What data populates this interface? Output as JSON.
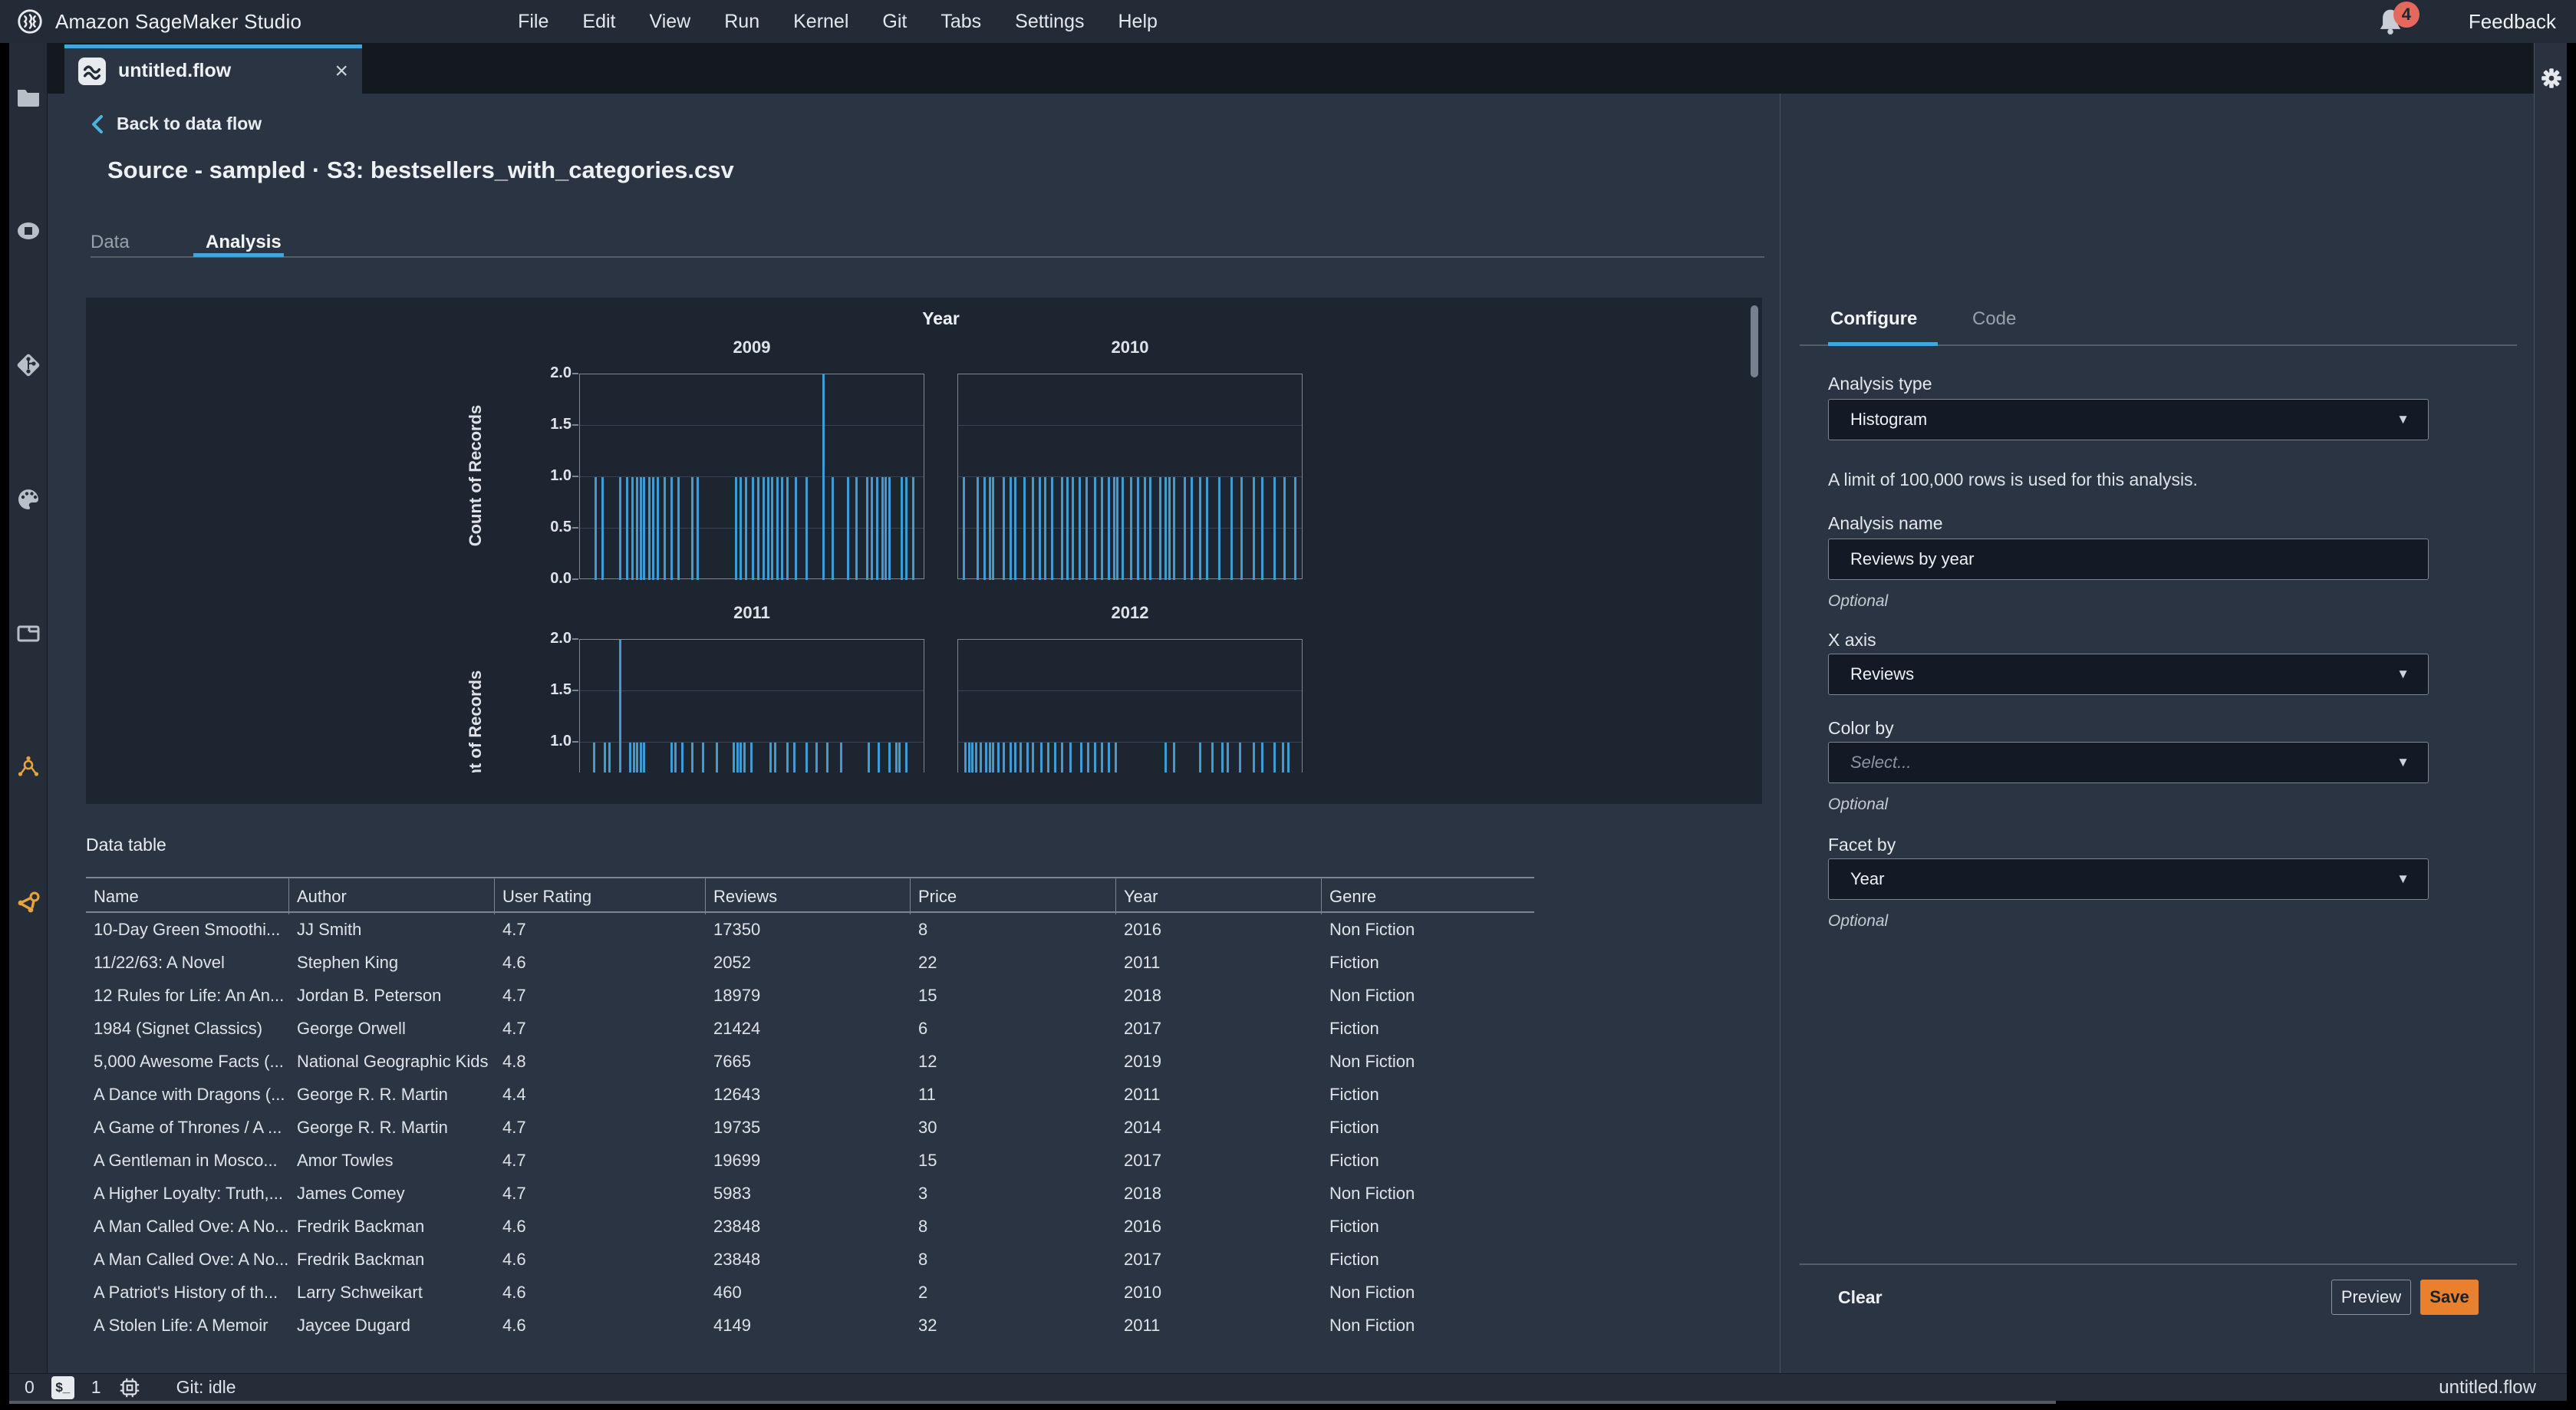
{
  "menu_bar": {
    "brand": "Amazon SageMaker Studio",
    "items": [
      "File",
      "Edit",
      "View",
      "Run",
      "Kernel",
      "Git",
      "Tabs",
      "Settings",
      "Help"
    ],
    "notification_count": "4",
    "feedback_label": "Feedback"
  },
  "sidebar": {
    "items": [
      {
        "name": "file-browser"
      },
      {
        "name": "running-sessions"
      },
      {
        "name": "git"
      },
      {
        "name": "commands-palette"
      },
      {
        "name": "open-tabs"
      },
      {
        "name": "experiments"
      },
      {
        "name": "data-flow"
      }
    ]
  },
  "tab_bar": {
    "active_tab": "untitled.flow",
    "close_glyph": "×"
  },
  "page": {
    "back_link": "Back to data flow",
    "title": "Source - sampled · S3: bestsellers_with_categories.csv",
    "tabs": [
      {
        "label": "Data",
        "active": false
      },
      {
        "label": "Analysis",
        "active": true
      }
    ]
  },
  "chart_data": {
    "type": "bar",
    "subtype": "histogram",
    "title": "Year",
    "ylabel": "Count of Records",
    "x_field": "Reviews",
    "facet_field": "Year",
    "ylim": [
      0,
      2
    ],
    "y_ticks_row1": [
      "2.0",
      "1.5",
      "1.0",
      "0.5",
      "0.0"
    ],
    "y_ticks_row2": [
      "2.0",
      "1.5",
      "1.0"
    ],
    "grid": true,
    "bar_color": "#3f9bd1",
    "facets": [
      {
        "year": "2009",
        "bars": [
          [
            0.045,
            1
          ],
          [
            0.065,
            1
          ],
          [
            0.115,
            1
          ],
          [
            0.135,
            1
          ],
          [
            0.15,
            1
          ],
          [
            0.165,
            1
          ],
          [
            0.175,
            1
          ],
          [
            0.185,
            1
          ],
          [
            0.2,
            1
          ],
          [
            0.21,
            1
          ],
          [
            0.225,
            1
          ],
          [
            0.245,
            1
          ],
          [
            0.265,
            1
          ],
          [
            0.285,
            1
          ],
          [
            0.325,
            1
          ],
          [
            0.34,
            1
          ],
          [
            0.45,
            1
          ],
          [
            0.465,
            1
          ],
          [
            0.48,
            1
          ],
          [
            0.5,
            1
          ],
          [
            0.515,
            1
          ],
          [
            0.53,
            1
          ],
          [
            0.545,
            1
          ],
          [
            0.555,
            1
          ],
          [
            0.57,
            1
          ],
          [
            0.585,
            1
          ],
          [
            0.6,
            1
          ],
          [
            0.625,
            1
          ],
          [
            0.655,
            1
          ],
          [
            0.705,
            2
          ],
          [
            0.73,
            1
          ],
          [
            0.775,
            1
          ],
          [
            0.8,
            1
          ],
          [
            0.83,
            1
          ],
          [
            0.845,
            1
          ],
          [
            0.86,
            1
          ],
          [
            0.875,
            1
          ],
          [
            0.885,
            1
          ],
          [
            0.895,
            1
          ],
          [
            0.93,
            1
          ],
          [
            0.945,
            1
          ],
          [
            0.965,
            1
          ]
        ]
      },
      {
        "year": "2010",
        "bars": [
          [
            0.015,
            1
          ],
          [
            0.055,
            1
          ],
          [
            0.075,
            1
          ],
          [
            0.09,
            1
          ],
          [
            0.1,
            1
          ],
          [
            0.13,
            1
          ],
          [
            0.15,
            1
          ],
          [
            0.165,
            1
          ],
          [
            0.19,
            1
          ],
          [
            0.215,
            1
          ],
          [
            0.235,
            1
          ],
          [
            0.25,
            1
          ],
          [
            0.27,
            1
          ],
          [
            0.3,
            1
          ],
          [
            0.315,
            1
          ],
          [
            0.33,
            1
          ],
          [
            0.35,
            1
          ],
          [
            0.37,
            1
          ],
          [
            0.395,
            1
          ],
          [
            0.415,
            1
          ],
          [
            0.435,
            1
          ],
          [
            0.45,
            1
          ],
          [
            0.46,
            1
          ],
          [
            0.475,
            1
          ],
          [
            0.5,
            1
          ],
          [
            0.52,
            1
          ],
          [
            0.54,
            1
          ],
          [
            0.555,
            1
          ],
          [
            0.585,
            1
          ],
          [
            0.6,
            1
          ],
          [
            0.61,
            1
          ],
          [
            0.625,
            1
          ],
          [
            0.655,
            1
          ],
          [
            0.675,
            1
          ],
          [
            0.7,
            1
          ],
          [
            0.72,
            1
          ],
          [
            0.755,
            1
          ],
          [
            0.79,
            1
          ],
          [
            0.82,
            1
          ],
          [
            0.855,
            1
          ],
          [
            0.88,
            1
          ],
          [
            0.915,
            1
          ],
          [
            0.945,
            1
          ],
          [
            0.975,
            1
          ]
        ]
      },
      {
        "year": "2011",
        "bars": [
          [
            0.04,
            1
          ],
          [
            0.07,
            1
          ],
          [
            0.085,
            1
          ],
          [
            0.115,
            2
          ],
          [
            0.145,
            1
          ],
          [
            0.155,
            1
          ],
          [
            0.165,
            1
          ],
          [
            0.175,
            1
          ],
          [
            0.185,
            1
          ],
          [
            0.265,
            1
          ],
          [
            0.275,
            1
          ],
          [
            0.295,
            1
          ],
          [
            0.325,
            1
          ],
          [
            0.355,
            1
          ],
          [
            0.395,
            1
          ],
          [
            0.445,
            1
          ],
          [
            0.455,
            1
          ],
          [
            0.465,
            1
          ],
          [
            0.475,
            1
          ],
          [
            0.495,
            1
          ],
          [
            0.55,
            1
          ],
          [
            0.565,
            1
          ],
          [
            0.6,
            1
          ],
          [
            0.62,
            1
          ],
          [
            0.655,
            1
          ],
          [
            0.685,
            1
          ],
          [
            0.715,
            1
          ],
          [
            0.755,
            1
          ],
          [
            0.835,
            1
          ],
          [
            0.865,
            1
          ],
          [
            0.895,
            1
          ],
          [
            0.915,
            1
          ],
          [
            0.925,
            1
          ],
          [
            0.945,
            1
          ]
        ]
      },
      {
        "year": "2012",
        "bars": [
          [
            0.02,
            1
          ],
          [
            0.03,
            1
          ],
          [
            0.04,
            1
          ],
          [
            0.05,
            1
          ],
          [
            0.065,
            1
          ],
          [
            0.08,
            1
          ],
          [
            0.09,
            1
          ],
          [
            0.1,
            1
          ],
          [
            0.115,
            1
          ],
          [
            0.13,
            1
          ],
          [
            0.15,
            1
          ],
          [
            0.165,
            1
          ],
          [
            0.18,
            1
          ],
          [
            0.2,
            1
          ],
          [
            0.215,
            1
          ],
          [
            0.24,
            1
          ],
          [
            0.26,
            1
          ],
          [
            0.28,
            1
          ],
          [
            0.3,
            1
          ],
          [
            0.325,
            1
          ],
          [
            0.355,
            1
          ],
          [
            0.375,
            1
          ],
          [
            0.395,
            1
          ],
          [
            0.415,
            1
          ],
          [
            0.435,
            1
          ],
          [
            0.455,
            1
          ],
          [
            0.6,
            1
          ],
          [
            0.625,
            1
          ],
          [
            0.7,
            1
          ],
          [
            0.735,
            1
          ],
          [
            0.765,
            1
          ],
          [
            0.78,
            1
          ],
          [
            0.815,
            1
          ],
          [
            0.855,
            1
          ],
          [
            0.88,
            1
          ],
          [
            0.915,
            1
          ],
          [
            0.94,
            1
          ],
          [
            0.955,
            1
          ]
        ]
      }
    ]
  },
  "data_table": {
    "label": "Data table",
    "columns": [
      "Name",
      "Author",
      "User Rating",
      "Reviews",
      "Price",
      "Year",
      "Genre"
    ],
    "rows": [
      [
        "10-Day Green Smoothi...",
        "JJ Smith",
        "4.7",
        "17350",
        "8",
        "2016",
        "Non Fiction"
      ],
      [
        "11/22/63: A Novel",
        "Stephen King",
        "4.6",
        "2052",
        "22",
        "2011",
        "Fiction"
      ],
      [
        "12 Rules for Life: An An...",
        "Jordan B. Peterson",
        "4.7",
        "18979",
        "15",
        "2018",
        "Non Fiction"
      ],
      [
        "1984 (Signet Classics)",
        "George Orwell",
        "4.7",
        "21424",
        "6",
        "2017",
        "Fiction"
      ],
      [
        "5,000 Awesome Facts (...",
        "National Geographic Kids",
        "4.8",
        "7665",
        "12",
        "2019",
        "Non Fiction"
      ],
      [
        "A Dance with Dragons (...",
        "George R. R. Martin",
        "4.4",
        "12643",
        "11",
        "2011",
        "Fiction"
      ],
      [
        "A Game of Thrones / A ...",
        "George R. R. Martin",
        "4.7",
        "19735",
        "30",
        "2014",
        "Fiction"
      ],
      [
        "A Gentleman in Mosco...",
        "Amor Towles",
        "4.7",
        "19699",
        "15",
        "2017",
        "Fiction"
      ],
      [
        "A Higher Loyalty: Truth,...",
        "James Comey",
        "4.7",
        "5983",
        "3",
        "2018",
        "Non Fiction"
      ],
      [
        "A Man Called Ove: A No...",
        "Fredrik Backman",
        "4.6",
        "23848",
        "8",
        "2016",
        "Fiction"
      ],
      [
        "A Man Called Ove: A No...",
        "Fredrik Backman",
        "4.6",
        "23848",
        "8",
        "2017",
        "Fiction"
      ],
      [
        "A Patriot's History of th...",
        "Larry Schweikart",
        "4.6",
        "460",
        "2",
        "2010",
        "Non Fiction"
      ],
      [
        "A Stolen Life: A Memoir",
        "Jaycee Dugard",
        "4.6",
        "4149",
        "32",
        "2011",
        "Non Fiction"
      ]
    ]
  },
  "config_panel": {
    "tabs": [
      {
        "label": "Configure",
        "active": true
      },
      {
        "label": "Code",
        "active": false
      }
    ],
    "analysis_type_label": "Analysis type",
    "analysis_type_value": "Histogram",
    "limit_note": "A limit of 100,000 rows is used for this analysis.",
    "analysis_name_label": "Analysis name",
    "analysis_name_value": "Reviews by year",
    "optional_label": "Optional",
    "x_axis_label": "X axis",
    "x_axis_value": "Reviews",
    "color_by_label": "Color by",
    "color_by_placeholder": "Select...",
    "facet_by_label": "Facet by",
    "facet_by_value": "Year",
    "clear_label": "Clear",
    "preview_label": "Preview",
    "save_label": "Save",
    "caret_glyph": "▼"
  },
  "status_bar": {
    "terminal_count": "0",
    "terminal_glyph": "$_",
    "kernel_count": "1",
    "git_status": "Git: idle",
    "filename": "untitled.flow"
  },
  "colors": {
    "accent_blue": "#42a5dc",
    "bar_blue": "#3f9bd1",
    "save_orange": "#e9802e",
    "badge_red": "#e4685e",
    "sidebar_orange": "#e8a33d",
    "chart_bg": "#1d2531",
    "content_bg": "#2b3442"
  }
}
